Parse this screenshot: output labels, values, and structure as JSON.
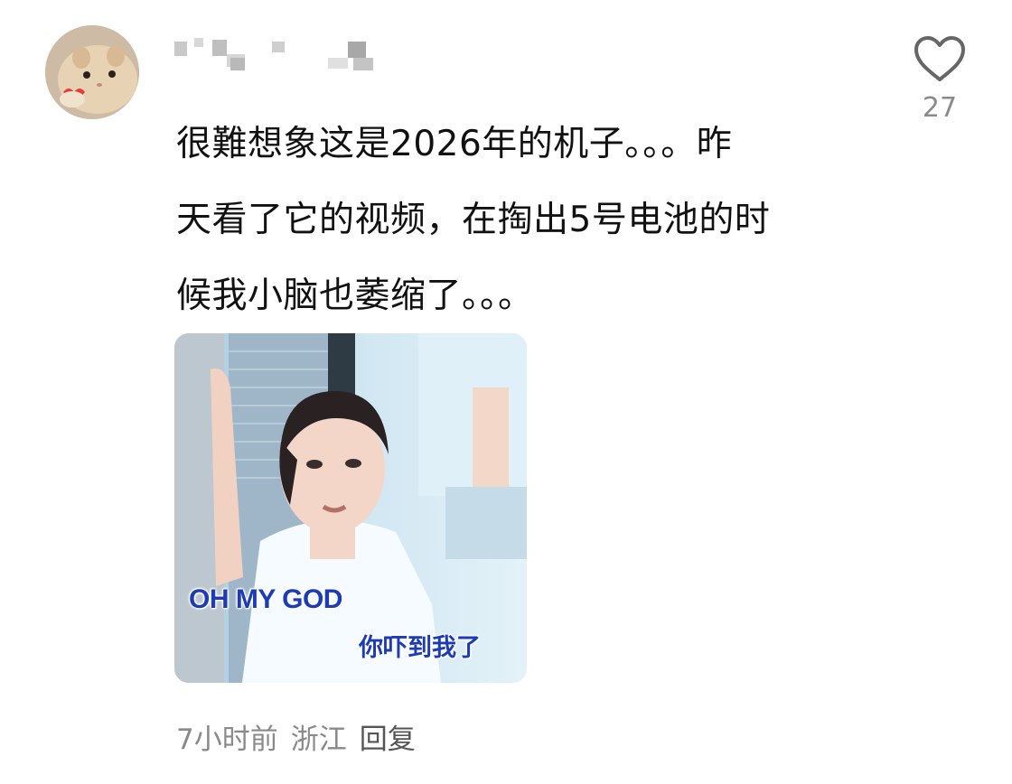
{
  "comment": {
    "username": "",
    "text_lines": [
      "很難想象这是2026年的机子。。。昨",
      "天看了它的视频，在掏出5号电池的时",
      "候我小脑也萎缩了。。。"
    ],
    "like_icon": "heart-outline-icon",
    "like_count": "27",
    "sticker": {
      "caption_en": "OH MY GOD",
      "caption_cn": "你吓到我了"
    },
    "meta": {
      "time": "7小时前",
      "location": "浙江",
      "reply": "回复"
    }
  },
  "colors": {
    "text": "#111111",
    "muted": "#8a8a8a",
    "caption": "#1d3bb3"
  }
}
